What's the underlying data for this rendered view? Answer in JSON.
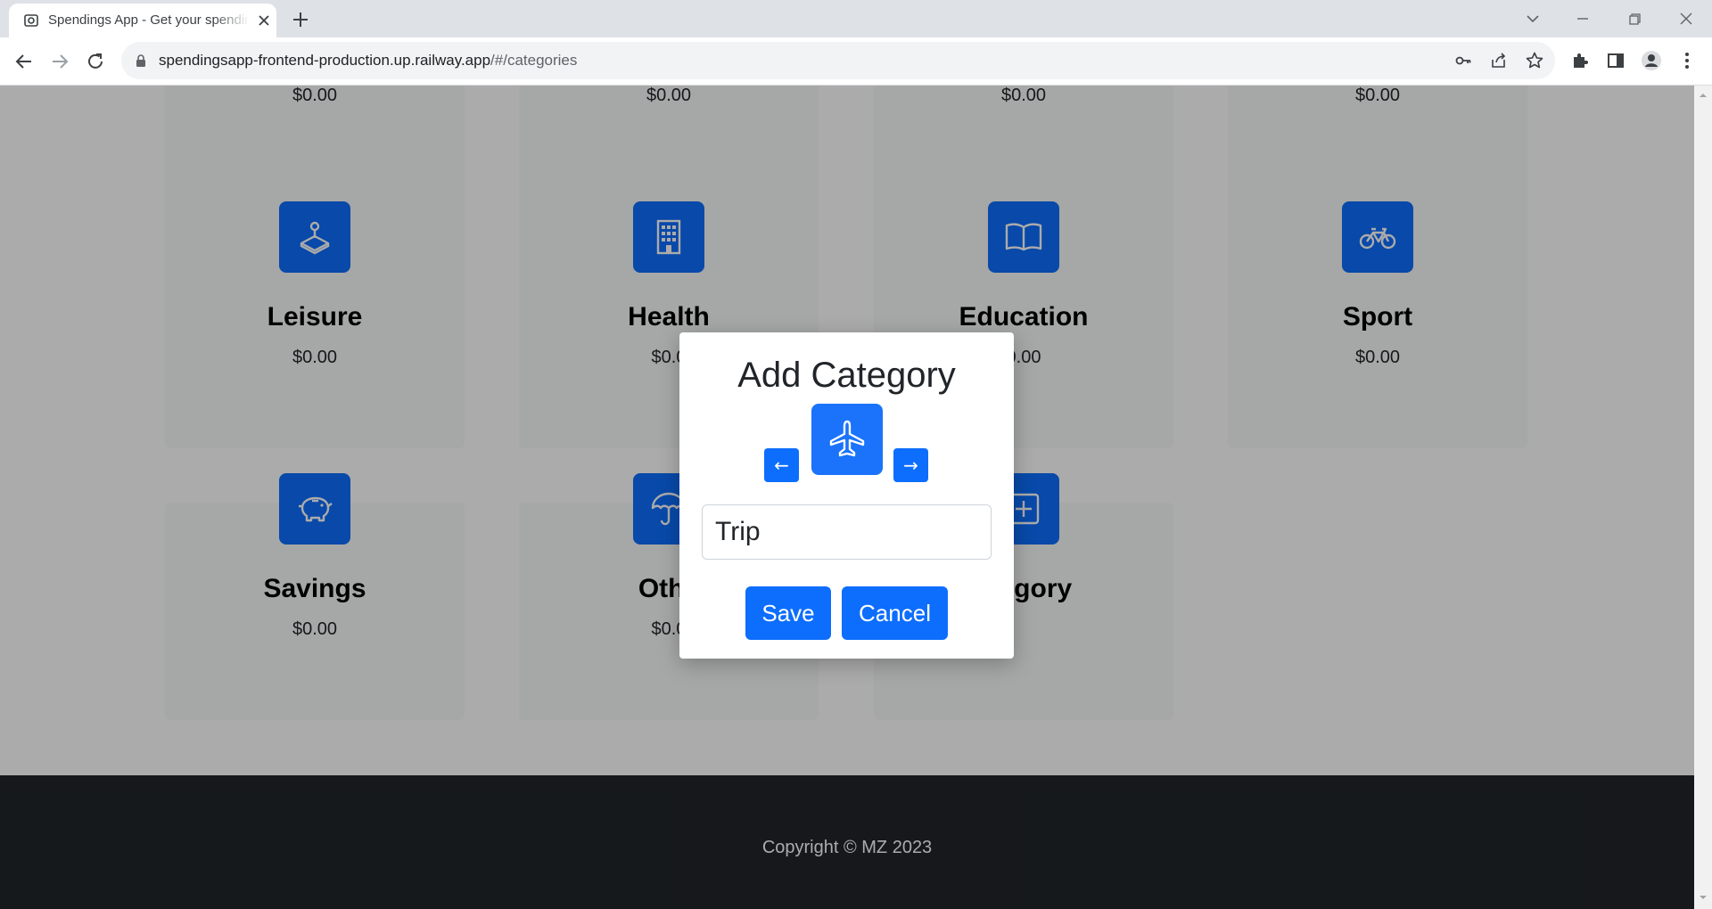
{
  "browser": {
    "tab_title": "Spendings App - Get your spendings",
    "url_host": "spendingsapp-frontend-production.up.railway.app",
    "url_path": "/#/categories"
  },
  "top_row_amounts": [
    "$0.00",
    "$0.00",
    "$0.00",
    "$0.00"
  ],
  "categories": [
    {
      "name": "Leisure",
      "amount": "$0.00",
      "icon": "joystick-icon"
    },
    {
      "name": "Health",
      "amount": "$0.0",
      "icon": "hospital-icon"
    },
    {
      "name": "Education",
      "amount": "0.00",
      "icon": "book-icon"
    },
    {
      "name": "Sport",
      "amount": "$0.00",
      "icon": "bicycle-icon"
    },
    {
      "name": "Savings",
      "amount": "$0.00",
      "icon": "piggy-bank-icon"
    },
    {
      "name": "Othe",
      "amount": "$0.0",
      "icon": "umbrella-icon"
    },
    {
      "name": "ategory",
      "amount": "",
      "icon": "plus-square-icon"
    }
  ],
  "footer": {
    "text": "Copyright © MZ 2023"
  },
  "modal": {
    "title": "Add Category",
    "prev_label": "←",
    "next_label": "→",
    "selected_icon": "airplane-icon",
    "name_value": "Trip",
    "save_label": "Save",
    "cancel_label": "Cancel"
  },
  "colors": {
    "primary": "#0d6efd",
    "footer_bg": "#212529",
    "card_bg": "#f8f9fa"
  }
}
